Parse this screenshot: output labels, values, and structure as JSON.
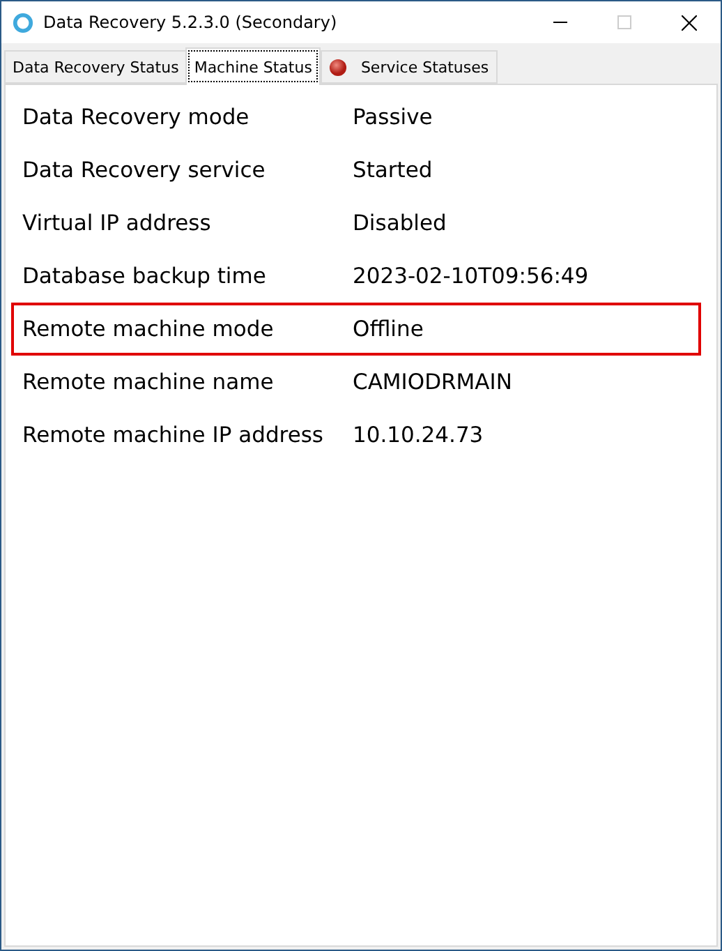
{
  "window": {
    "title": "Data Recovery 5.2.3.0 (Secondary)"
  },
  "tabs": [
    {
      "label": "Data Recovery Status",
      "selected": false,
      "indicator": false
    },
    {
      "label": "Machine Status",
      "selected": true,
      "indicator": false
    },
    {
      "label": "Service Statuses",
      "selected": false,
      "indicator": true
    }
  ],
  "rows": [
    {
      "label": "Data Recovery mode",
      "value": "Passive",
      "highlighted": false
    },
    {
      "label": "Data Recovery service",
      "value": "Started",
      "highlighted": false
    },
    {
      "label": "Virtual IP address",
      "value": "Disabled",
      "highlighted": false
    },
    {
      "label": "Database backup time",
      "value": "2023-02-10T09:56:49",
      "highlighted": false
    },
    {
      "label": "Remote machine mode",
      "value": "Offline",
      "highlighted": true
    },
    {
      "label": "Remote machine name",
      "value": "CAMIODRMAIN",
      "highlighted": false
    },
    {
      "label": "Remote machine IP address",
      "value": "10.10.24.73",
      "highlighted": false
    }
  ]
}
